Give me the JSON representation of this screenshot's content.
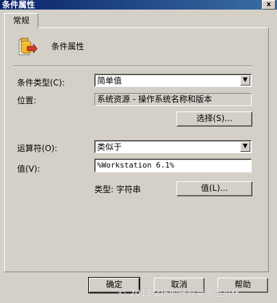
{
  "window": {
    "title": "条件属性",
    "close_glyph": "x"
  },
  "tabs": [
    {
      "label": "常规"
    }
  ],
  "header": {
    "title": "条件属性",
    "icon": "condition-properties-icon"
  },
  "form": {
    "condition_type": {
      "label": "条件类型(C):",
      "value": "简单值"
    },
    "location": {
      "label": "位置:",
      "value": "系统资源 - 操作系统名称和版本"
    },
    "select_button": "选择(S)...",
    "operator": {
      "label": "运算符(O):",
      "value": "类似于"
    },
    "value": {
      "label": "值(V):",
      "value": "%Workstation 6.1%"
    },
    "type_label": "类型: 字符串",
    "value_button": "值(L)..."
  },
  "footer": {
    "ok": "确定",
    "cancel": "取消",
    "help": "帮助"
  },
  "watermark": "© 2012 ZJS的微软桌面虚拟化",
  "colors": {
    "face": "#d4d0c8",
    "title_start": "#0a246a",
    "title_end": "#3a6ea5"
  }
}
